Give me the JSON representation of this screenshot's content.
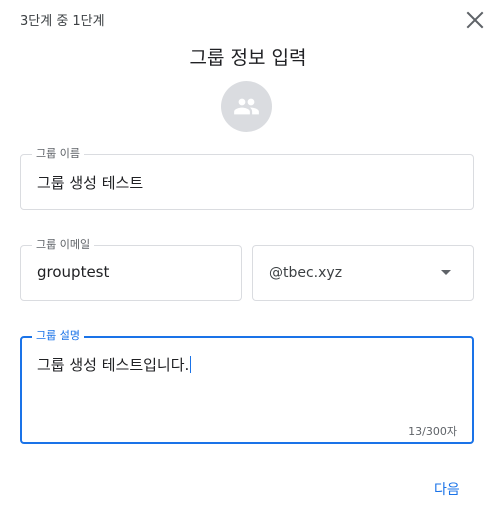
{
  "dialog": {
    "step_text": "3단계 중 1단계",
    "title": "그룹 정보 입력",
    "accent_color": "#1a73e8"
  },
  "form": {
    "group_name": {
      "label": "그룹 이름",
      "value": "그룹 생성 테스트"
    },
    "group_email": {
      "label": "그룹 이메일",
      "value": "grouptest"
    },
    "domain": {
      "selected": "@tbec.xyz"
    },
    "group_description": {
      "label": "그룹 설명",
      "value": "그룹 생성 테스트입니다.",
      "counter": "13/300자"
    }
  },
  "actions": {
    "next_label": "다음"
  },
  "icons": {
    "close": "close-icon",
    "avatar": "group-icon",
    "dropdown": "dropdown-arrow-icon"
  }
}
